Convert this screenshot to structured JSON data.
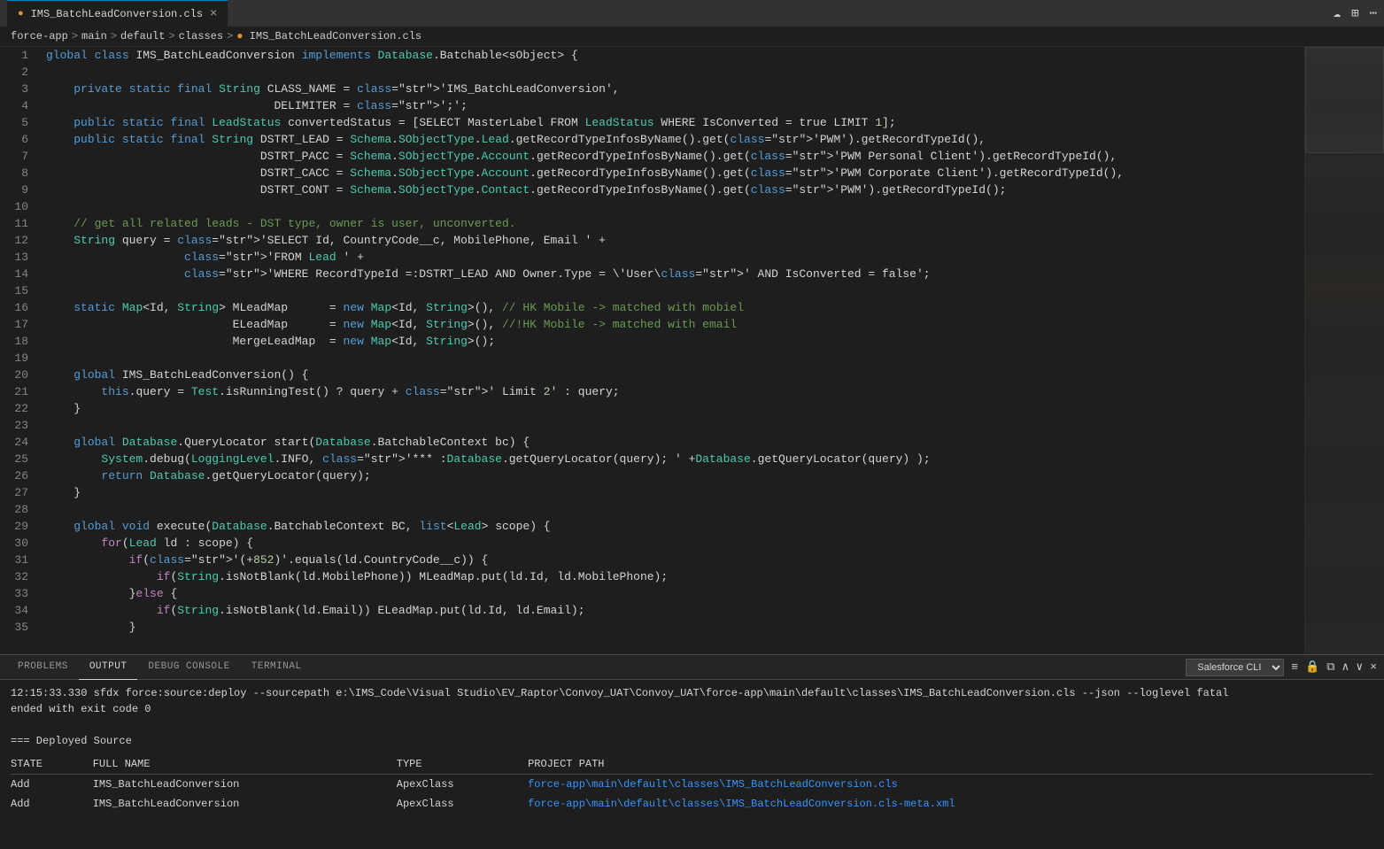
{
  "titleBar": {
    "tab": {
      "icon": "●",
      "name": "IMS_BatchLeadConversion.cls",
      "close": "×"
    },
    "icons": [
      "☁",
      "⊞",
      "⋯"
    ]
  },
  "breadcrumb": {
    "parts": [
      "force-app",
      ">",
      "main",
      ">",
      "default",
      ">",
      "classes",
      ">",
      "IMS_BatchLeadConversion.cls"
    ]
  },
  "panel": {
    "tabs": [
      "PROBLEMS",
      "OUTPUT",
      "DEBUG CONSOLE",
      "TERMINAL"
    ],
    "activeTab": "OUTPUT",
    "dropdownLabel": "Salesforce CLI",
    "content": {
      "line1": "12:15:33.330 sfdx force:source:deploy --sourcepath e:\\IMS_Code\\Visual Studio\\EV_Raptor\\Convoy_UAT\\Convoy_UAT\\force-app\\main\\default\\classes\\IMS_BatchLeadConversion.cls --json --loglevel fatal",
      "line2": "ended with exit code 0",
      "line3": "",
      "line4": "=== Deployed Source",
      "tableHeaders": [
        "STATE",
        "FULL NAME",
        "TYPE",
        "PROJECT PATH"
      ],
      "tableRows": [
        [
          "Add",
          "IMS_BatchLeadConversion",
          "ApexClass",
          "force-app\\main\\default\\classes\\IMS_BatchLeadConversion.cls"
        ],
        [
          "Add",
          "IMS_BatchLeadConversion",
          "ApexClass",
          "force-app\\main\\default\\classes\\IMS_BatchLeadConversion.cls-meta.xml"
        ]
      ]
    }
  },
  "codeLines": [
    {
      "num": 1,
      "text": "global class IMS_BatchLeadConversion implements Database.Batchable<sObject> {"
    },
    {
      "num": 2,
      "text": ""
    },
    {
      "num": 3,
      "text": "    private static final String CLASS_NAME = 'IMS_BatchLeadConversion',"
    },
    {
      "num": 4,
      "text": "                                 DELIMITER = ';';"
    },
    {
      "num": 5,
      "text": "    public static final LeadStatus convertedStatus = [SELECT MasterLabel FROM LeadStatus WHERE IsConverted = true LIMIT 1];"
    },
    {
      "num": 6,
      "text": "    public static final String DSTRT_LEAD = Schema.SObjectType.Lead.getRecordTypeInfosByName().get('PWM').getRecordTypeId(),"
    },
    {
      "num": 7,
      "text": "                               DSTRT_PACC = Schema.SObjectType.Account.getRecordTypeInfosByName().get('PWM Personal Client').getRecordTypeId(),"
    },
    {
      "num": 8,
      "text": "                               DSTRT_CACC = Schema.SObjectType.Account.getRecordTypeInfosByName().get('PWM Corporate Client').getRecordTypeId(),"
    },
    {
      "num": 9,
      "text": "                               DSTRT_CONT = Schema.SObjectType.Contact.getRecordTypeInfosByName().get('PWM').getRecordTypeId();"
    },
    {
      "num": 10,
      "text": ""
    },
    {
      "num": 11,
      "text": "    // get all related leads - DST type, owner is user, unconverted."
    },
    {
      "num": 12,
      "text": "    String query = 'SELECT Id, CountryCode__c, MobilePhone, Email ' +"
    },
    {
      "num": 13,
      "text": "                    'FROM Lead ' +"
    },
    {
      "num": 14,
      "text": "                    'WHERE RecordTypeId =:DSTRT_LEAD AND Owner.Type = \\'User\\' AND IsConverted = false';"
    },
    {
      "num": 15,
      "text": ""
    },
    {
      "num": 16,
      "text": "    static Map<Id, String> MLeadMap      = new Map<Id, String>(), // HK Mobile -> matched with mobiel"
    },
    {
      "num": 17,
      "text": "                           ELeadMap      = new Map<Id, String>(), //!HK Mobile -> matched with email"
    },
    {
      "num": 18,
      "text": "                           MergeLeadMap  = new Map<Id, String>();"
    },
    {
      "num": 19,
      "text": ""
    },
    {
      "num": 20,
      "text": "    global IMS_BatchLeadConversion() {"
    },
    {
      "num": 21,
      "text": "        this.query = Test.isRunningTest() ? query + ' Limit 2' : query;"
    },
    {
      "num": 22,
      "text": "    }"
    },
    {
      "num": 23,
      "text": ""
    },
    {
      "num": 24,
      "text": "    global Database.QueryLocator start(Database.BatchableContext bc) {"
    },
    {
      "num": 25,
      "text": "        System.debug(LoggingLevel.INFO, '*** :Database.getQueryLocator(query); ' +Database.getQueryLocator(query) );"
    },
    {
      "num": 26,
      "text": "        return Database.getQueryLocator(query);"
    },
    {
      "num": 27,
      "text": "    }"
    },
    {
      "num": 28,
      "text": ""
    },
    {
      "num": 29,
      "text": "    global void execute(Database.BatchableContext BC, list<Lead> scope) {"
    },
    {
      "num": 30,
      "text": "        for(Lead ld : scope) {"
    },
    {
      "num": 31,
      "text": "            if('(+852)'.equals(ld.CountryCode__c)) {"
    },
    {
      "num": 32,
      "text": "                if(String.isNotBlank(ld.MobilePhone)) MLeadMap.put(ld.Id, ld.MobilePhone);"
    },
    {
      "num": 33,
      "text": "            }else {"
    },
    {
      "num": 34,
      "text": "                if(String.isNotBlank(ld.Email)) ELeadMap.put(ld.Id, ld.Email);"
    },
    {
      "num": 35,
      "text": "            }"
    }
  ]
}
